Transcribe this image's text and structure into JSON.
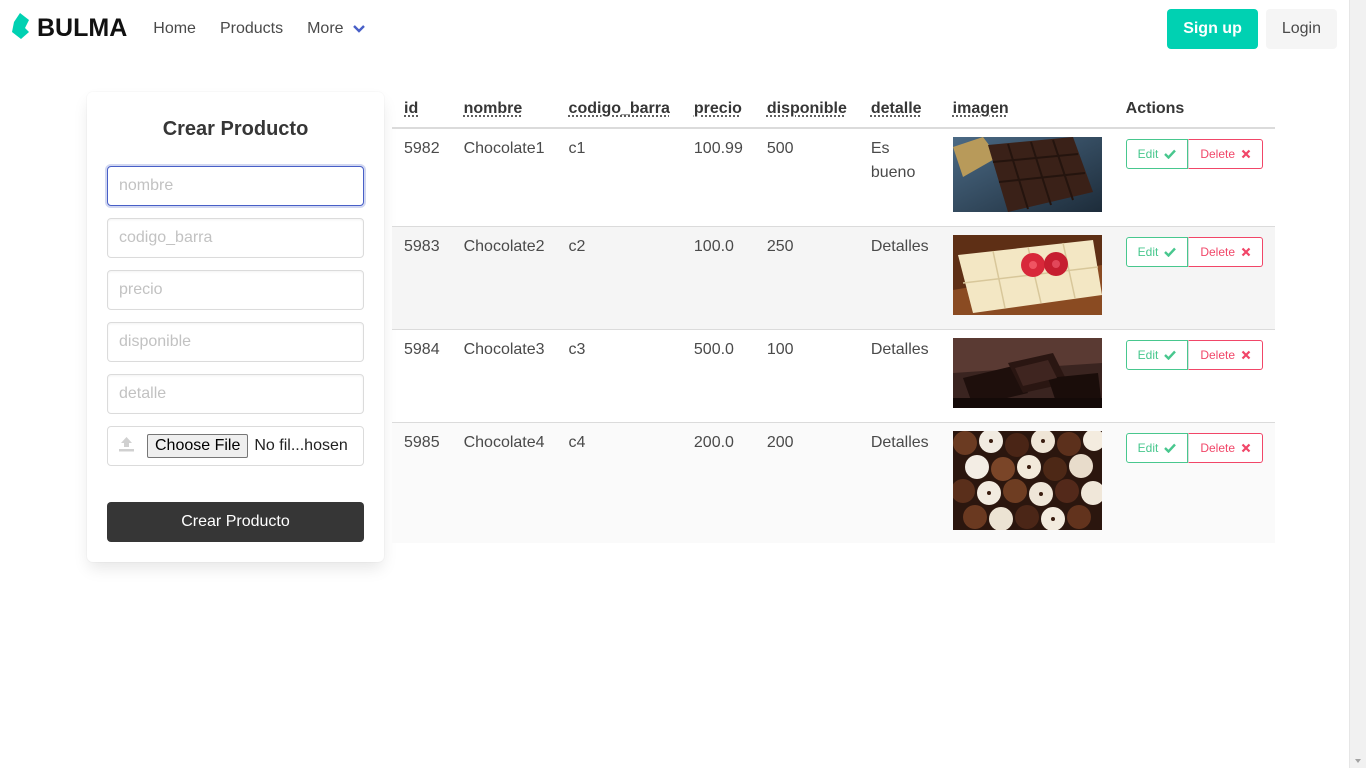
{
  "navbar": {
    "brand": "BULMA",
    "links": [
      "Home",
      "Products",
      "More"
    ],
    "signup_label": "Sign up",
    "login_label": "Login"
  },
  "form": {
    "title": "Crear Producto",
    "placeholders": {
      "nombre": "nombre",
      "codigo_barra": "codigo_barra",
      "precio": "precio",
      "disponible": "disponible",
      "detalle": "detalle"
    },
    "choose_file_label": "Choose File",
    "file_name": "No fil...hosen",
    "submit_label": "Crear Producto"
  },
  "table": {
    "headers": [
      "id",
      "nombre",
      "codigo_barra",
      "precio",
      "disponible",
      "detalle",
      "imagen",
      "Actions"
    ],
    "edit_label": "Edit",
    "delete_label": "Delete",
    "rows": [
      {
        "id": "5982",
        "nombre": "Chocolate1",
        "codigo_barra": "c1",
        "precio": "100.99",
        "disponible": "500",
        "detalle": "Es bueno",
        "image": "dark-chocolate-bar-image"
      },
      {
        "id": "5983",
        "nombre": "Chocolate2",
        "codigo_barra": "c2",
        "precio": "100.0",
        "disponible": "250",
        "detalle": "Detalles",
        "image": "white-chocolate-raspberry-image"
      },
      {
        "id": "5984",
        "nombre": "Chocolate3",
        "codigo_barra": "c3",
        "precio": "500.0",
        "disponible": "100",
        "detalle": "Detalles",
        "image": "dark-chocolate-pieces-image"
      },
      {
        "id": "5985",
        "nombre": "Chocolate4",
        "codigo_barra": "c4",
        "precio": "200.0",
        "disponible": "200",
        "detalle": "Detalles",
        "image": "assorted-truffles-image"
      }
    ]
  },
  "colors": {
    "primary": "#00d1b2",
    "success": "#48c78e",
    "danger": "#f14668",
    "dark": "#363636",
    "link": "#485fc7"
  }
}
